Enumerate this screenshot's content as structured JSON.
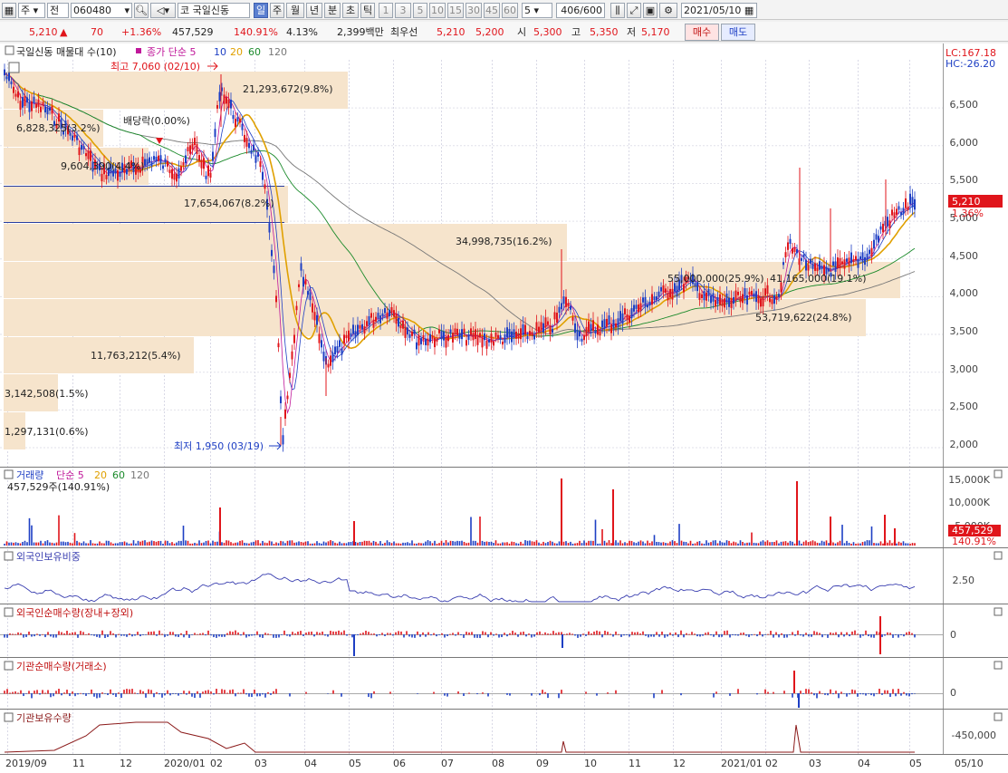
{
  "toolbar": {
    "market_label": "주",
    "jeon_label": "전",
    "code": "060480",
    "kospi_icon_label": "코",
    "stock_name": "국일신동",
    "periods": [
      "일",
      "주",
      "월",
      "년",
      "분",
      "초",
      "틱"
    ],
    "active_period": "일",
    "minutes": [
      "1",
      "3",
      "5",
      "10",
      "15",
      "30",
      "45",
      "60"
    ],
    "count_select": "5",
    "range": "406/600",
    "date": "2021/05/10"
  },
  "quote": {
    "price": "5,210",
    "arrow": "▲",
    "change": "70",
    "change_pct": "+1.36%",
    "volume": "457,529",
    "volume_ratio": "140.91%",
    "turnover": "4.13%",
    "amount": "2,399백만",
    "best_label": "최우선",
    "best_ask": "5,210",
    "best_bid": "5,200",
    "open_label": "시",
    "open": "5,300",
    "high_label": "고",
    "high": "5,350",
    "low_label": "저",
    "low": "5,170",
    "buy_label": "매수",
    "sell_label": "매도"
  },
  "chart": {
    "legend_volume_profile": "국일신동 매물대 수(10)",
    "legend_price": "종가 단순 5",
    "legend_ma": [
      "10",
      "20",
      "60",
      "120"
    ],
    "lc": "LC:167.18",
    "hc": "HC:-26.20",
    "price_axis": [
      "6,500",
      "6,000",
      "5,500",
      "5,000",
      "4,500",
      "4,000",
      "3,500",
      "3,000",
      "2,500",
      "2,000"
    ],
    "current_price_tag": "5,210",
    "current_pct_tag": "1.36%",
    "high_annot": "최고 7,060 (02/10)",
    "low_annot": "최저 1,950 (03/19)",
    "dividend_annot": "배당락(0.00%)",
    "profile_labels": [
      "21,293,672(9.8%)",
      "6,828,325(3.2%)",
      "9,604,390(4.4%)",
      "17,654,067(8.2%)",
      "34,998,735(16.2%)",
      "55,000,000(25.9%)",
      "41,165,000(19.1%)",
      "53,719,622(24.8%)",
      "11,763,212(5.4%)",
      "3,142,508(1.5%)",
      "1,297,131(0.6%)"
    ],
    "vol_title": "거래량",
    "vol_ma_label": "단순 5",
    "vol_ma": [
      "20",
      "60",
      "120"
    ],
    "vol_value": "457,529주(140.91%)",
    "vol_axis": [
      "15,000K",
      "10,000K",
      "5,000K"
    ],
    "vol_tag": "457,529",
    "vol_pct_tag": "140.91%",
    "foreign_ratio_title": "외국인보유비중",
    "foreign_ratio_axis": "2.50",
    "foreign_net_title": "외국인순매수량(장내+장외)",
    "foreign_net_axis": "0",
    "inst_net_title": "기관순매수량(거래소)",
    "inst_net_axis": "0",
    "inst_hold_title": "기관보유수량",
    "inst_hold_axis": "-450,000",
    "x_axis": [
      "2019/09",
      "11",
      "12",
      "2020/01",
      "02",
      "03",
      "04",
      "05",
      "06",
      "07",
      "08",
      "09",
      "10",
      "11",
      "12",
      "2021/01",
      "02",
      "03",
      "04",
      "05"
    ],
    "x_end": "05/10"
  },
  "colors": {
    "up": "#e0151b",
    "down": "#1e3fc4",
    "ma5": "#c0189a",
    "ma20": "#e0a000",
    "ma60": "#1a8a2a",
    "ma120": "#777777",
    "profile": "#f6e4cc"
  }
}
